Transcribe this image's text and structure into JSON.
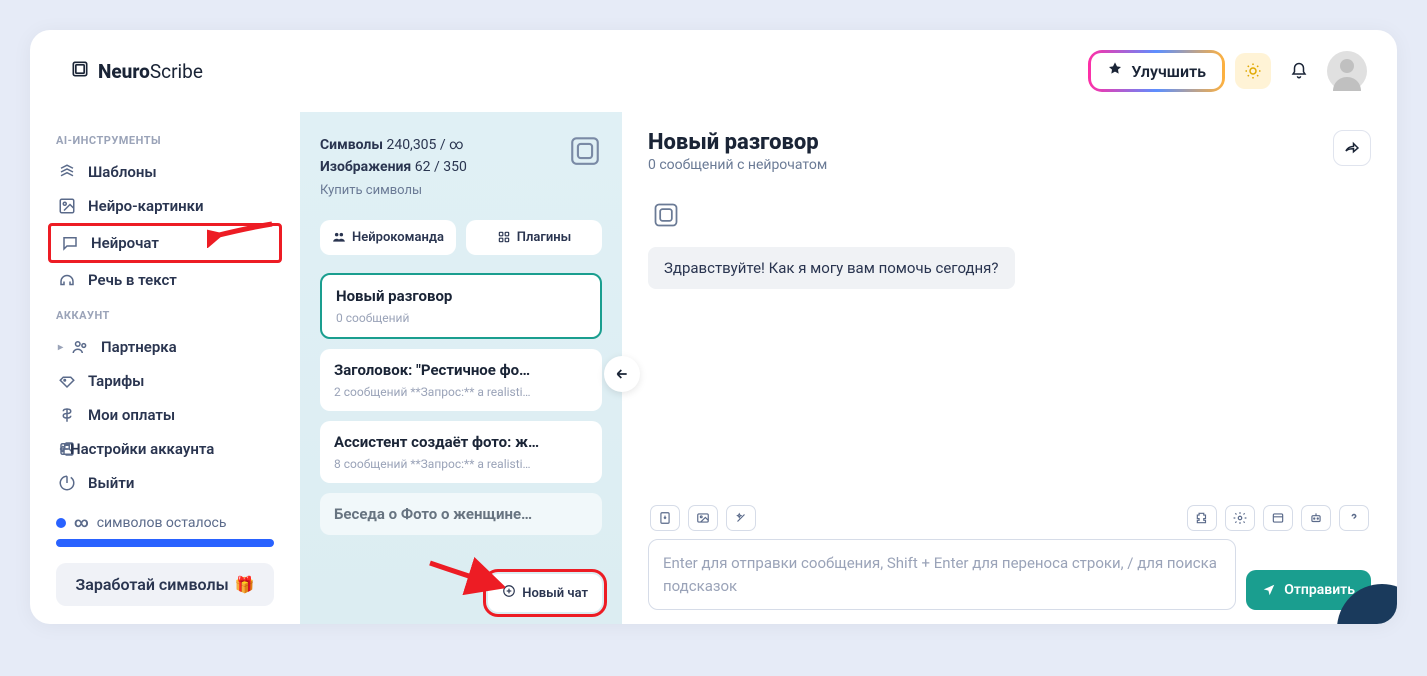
{
  "brand": {
    "part1": "Neuro",
    "part2": "Scribe"
  },
  "header": {
    "upgrade": "Улучшить"
  },
  "sidebar": {
    "section1_title": "AI-ИНСТРУМЕНТЫ",
    "items1": [
      {
        "label": "Шаблоны"
      },
      {
        "label": "Нейро-картинки"
      },
      {
        "label": "Нейрочат"
      },
      {
        "label": "Речь в текст"
      }
    ],
    "section2_title": "АККАУНТ",
    "items2": [
      {
        "label": "Партнерка"
      },
      {
        "label": "Тарифы"
      },
      {
        "label": "Мои оплаты"
      },
      {
        "label": "Настройки аккаунта"
      },
      {
        "label": "Выйти"
      }
    ],
    "infinity": "∞",
    "symbols_left": "символов осталось",
    "earn": "Заработай символы"
  },
  "middle": {
    "symbols_label": "Символы",
    "symbols_value": "240,305 / ∞",
    "images_label": "Изображения",
    "images_value": "62 / 350",
    "buy": "Купить символы",
    "tab1": "Нейрокоманда",
    "tab2": "Плагины",
    "convos": [
      {
        "title": "Новый разговор",
        "sub": "0 сообщений"
      },
      {
        "title": "Заголовок: \"Рестичное фо…",
        "sub": "2 сообщений   **Запрос:** a realisti…"
      },
      {
        "title": "Ассистент создаёт фото: ж…",
        "sub": "8 сообщений   **Запрос:** a realisti…"
      },
      {
        "title": "Беседа о Фото о женщине…",
        "sub": ""
      }
    ],
    "new_chat": "Новый чат"
  },
  "main": {
    "title": "Новый разговор",
    "subtitle": "0 сообщений с нейрочатом",
    "greeting": "Здравствуйте! Как я могу вам помочь сегодня?",
    "placeholder": "Enter для отправки сообщения, Shift + Enter для переноса строки, / для поиска подсказок",
    "send": "Отправить"
  }
}
